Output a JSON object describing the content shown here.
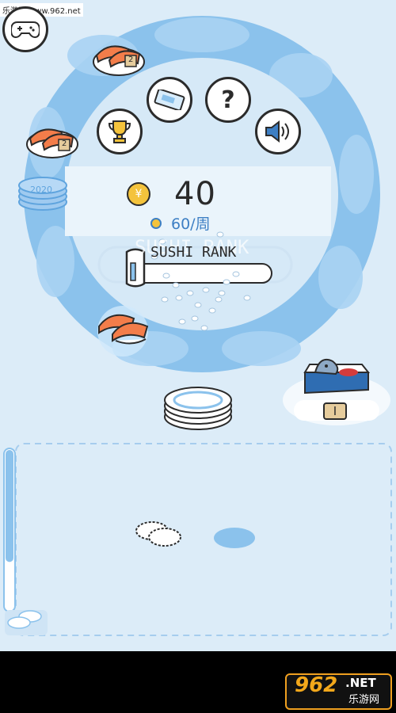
{
  "watermark": {
    "site": "乐游网 www.962.net"
  },
  "menu": {
    "buttons": [
      {
        "icon": "gamepad-icon"
      },
      {
        "icon": "ticket-icon"
      },
      {
        "icon": "help-icon",
        "glyph": "?"
      },
      {
        "icon": "trophy-icon"
      },
      {
        "icon": "speaker-icon"
      }
    ]
  },
  "stats": {
    "coins": "40",
    "rate": "60/周",
    "rank_title": "SUSHI RANK",
    "rank_ghost": "SUSHI RANK",
    "coin_symbol": "¥"
  },
  "rank": {
    "progress": 0.05
  },
  "counter": {
    "level": "I"
  },
  "stack": {
    "plate_counter": "2020"
  },
  "sushi_plates": [
    {
      "tag": "2"
    },
    {
      "tag": "2"
    }
  ],
  "logo": {
    "num": "962",
    "net": ".NET",
    "cn": "乐游网"
  },
  "colors": {
    "background": "#dcecf8",
    "ring": "#8bc2ec",
    "ring_dark": "#6aaee4",
    "accent_blue": "#3d7fc4",
    "salmon": "#f37d4a",
    "coin": "#f4c33c"
  },
  "feed": {
    "level": 0.7
  }
}
